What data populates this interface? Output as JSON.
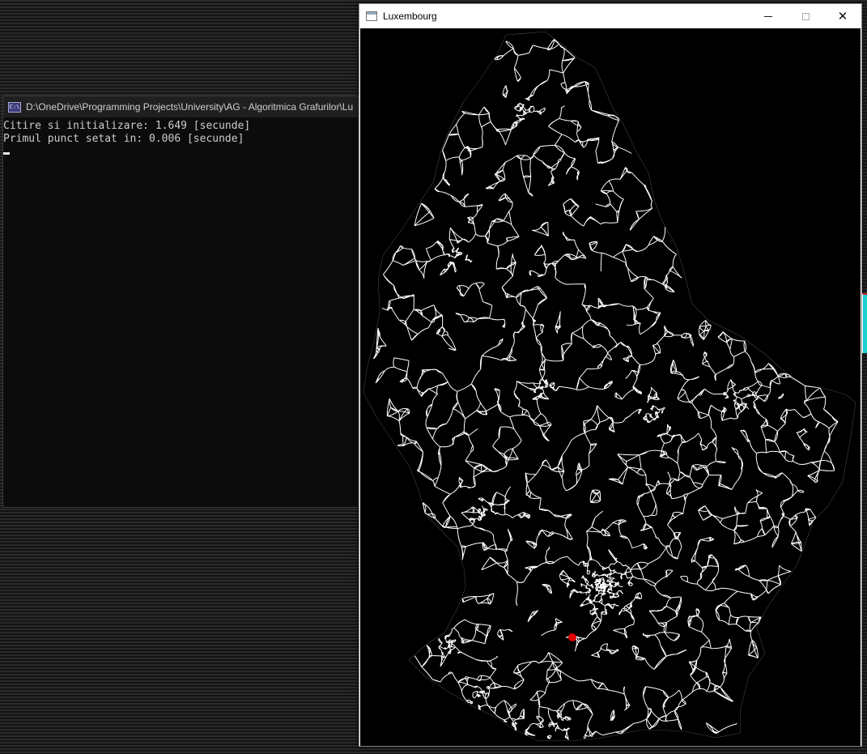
{
  "console": {
    "title": "D:\\OneDrive\\Programming Projects\\University\\AG - Algoritmica Grafurilor\\Lu",
    "icon": "cmd-icon",
    "lines": [
      "Citire si initializare: 1.649 [secunde]",
      "Primul punct setat in: 0.006 [secunde]"
    ]
  },
  "map_window": {
    "title": "Luxembourg",
    "icon": "app-window-icon",
    "minimize_icon": "minimize-icon",
    "maximize_icon": "maximize-icon",
    "close_icon": "close-icon",
    "close_glyph": "✕",
    "colors": {
      "background": "#000000",
      "roads": "#ffffff",
      "marker": "#e00000"
    }
  }
}
